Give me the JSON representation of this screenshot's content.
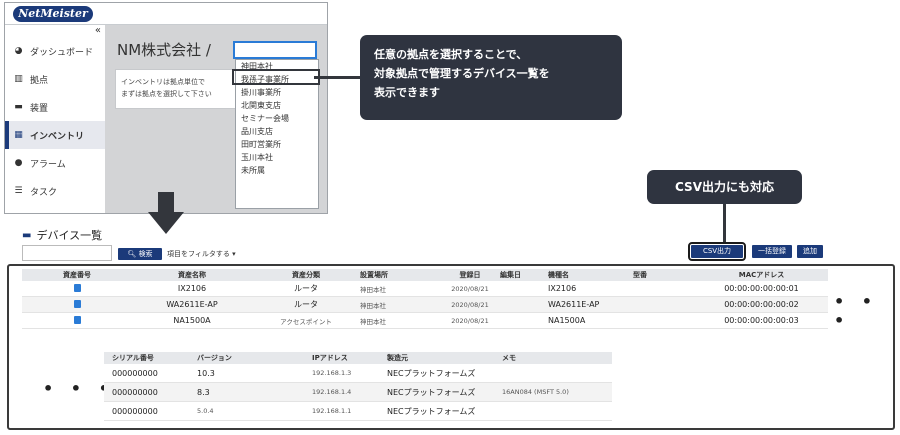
{
  "app": {
    "logo": "NetMeister"
  },
  "sidebar": {
    "collapse": "«",
    "items": [
      {
        "label": "ダッシュボード",
        "icon": "dashboard-icon"
      },
      {
        "label": "拠点",
        "icon": "building-icon"
      },
      {
        "label": "装置",
        "icon": "device-icon"
      },
      {
        "label": "インベントリ",
        "icon": "grid-icon",
        "active": true
      },
      {
        "label": "アラーム",
        "icon": "alert-icon"
      },
      {
        "label": "タスク",
        "icon": "list-icon"
      }
    ]
  },
  "inventory": {
    "company": "NM株式会社 /",
    "info_line1": "インベントリは拠点単位で",
    "info_line2": "まずは拠点を選択して下さい",
    "selected": "",
    "options": [
      "神田本社",
      "我孫子事業所",
      "掛川事業所",
      "北関東支店",
      "セミナー会場",
      "品川支店",
      "田町営業所",
      "玉川本社",
      "未所属"
    ]
  },
  "callouts": {
    "select_line1": "任意の拠点を選択することで、",
    "select_line2": "対象拠点で管理するデバイス一覧を",
    "select_line3": "表示できます",
    "csv": "CSV出力にも対応"
  },
  "device_list": {
    "title": "デバイス一覧",
    "search": "検索",
    "filter": "項目をフィルタする ▾",
    "csv": "CSV出力",
    "bulk": "一括登録",
    "add": "追加",
    "more": "• • •",
    "columns": [
      "資産番号",
      "資産名称",
      "資産分類",
      "設置場所",
      "登録日",
      "編集日",
      "機種名",
      "型番",
      "MACアドレス"
    ],
    "rows": [
      {
        "asset_name": "IX2106",
        "category": "ルータ",
        "location": "神田本社",
        "registered": "2020/08/21",
        "edited": "",
        "model": "IX2106",
        "part": "",
        "mac": "00:00:00:00:00:01"
      },
      {
        "asset_name": "WA2611E-AP",
        "category": "ルータ",
        "location": "神田本社",
        "registered": "2020/08/21",
        "edited": "",
        "model": "WA2611E-AP",
        "part": "",
        "mac": "00:00:00:00:00:02"
      },
      {
        "asset_name": "NA1500A",
        "category": "アクセスポイント",
        "location": "神田本社",
        "registered": "2020/08/21",
        "edited": "",
        "model": "NA1500A",
        "part": "",
        "mac": "00:00:00:00:00:03"
      }
    ],
    "columns2": [
      "シリアル番号",
      "バージョン",
      "IPアドレス",
      "製造元",
      "メモ"
    ],
    "rows2": [
      {
        "serial": "000000000",
        "version": "10.3",
        "ip": "192.168.1.3",
        "maker": "NECプラットフォームズ",
        "memo": ""
      },
      {
        "serial": "000000000",
        "version": "8.3",
        "ip": "192.168.1.4",
        "maker": "NECプラットフォームズ",
        "memo": "16AN084 (MSFT 5.0)"
      },
      {
        "serial": "000000000",
        "version": "5.0.4",
        "ip": "192.168.1.1",
        "maker": "NECプラットフォームズ",
        "memo": ""
      }
    ]
  },
  "colors": {
    "brand": "#1b3a7a",
    "callout": "#2f3440",
    "accent": "#2a7bd6"
  }
}
